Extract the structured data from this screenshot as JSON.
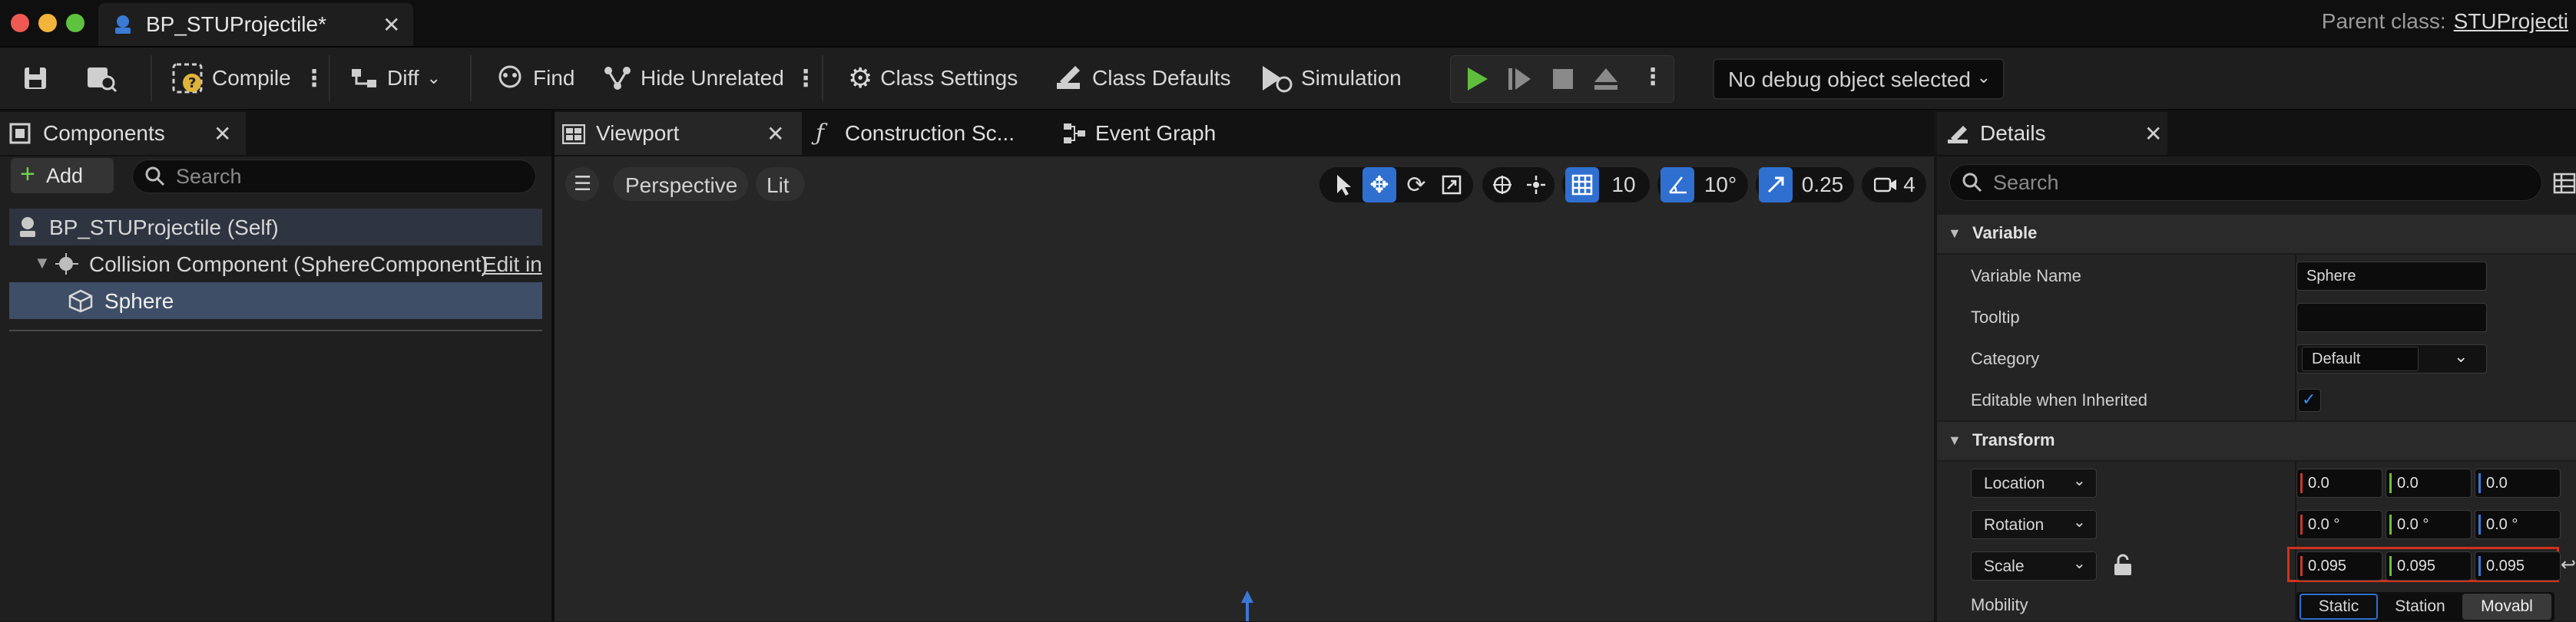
{
  "window": {
    "tab_title": "BP_STUProjectile*",
    "parent_class_label": "Parent class:",
    "parent_class_value": "STUProjecti"
  },
  "toolbar": {
    "compile": "Compile",
    "diff": "Diff",
    "find": "Find",
    "hide_unrelated": "Hide Unrelated",
    "class_settings": "Class Settings",
    "class_defaults": "Class Defaults",
    "simulation": "Simulation",
    "debug_object": "No debug object selected"
  },
  "components": {
    "tab_label": "Components",
    "add_label": "Add",
    "search_placeholder": "Search",
    "tree": [
      {
        "label": "BP_STUProjectile (Self)"
      },
      {
        "label": "Collision Component (SphereComponent)",
        "suffix": "Edit in"
      },
      {
        "label": "Sphere",
        "selected": true
      }
    ]
  },
  "viewport": {
    "tabs": [
      {
        "label": "Viewport"
      },
      {
        "label": "Construction Sc..."
      },
      {
        "label": "Event Graph"
      }
    ],
    "perspective_label": "Perspective",
    "lit_label": "Lit",
    "grid_snap": "10",
    "rotation_snap": "10°",
    "scale_snap": "0.25",
    "camera_speed": "4"
  },
  "details": {
    "tab_label": "Details",
    "search_placeholder": "Search",
    "sections": {
      "variable": "Variable",
      "transform": "Transform"
    },
    "variable": {
      "name_label": "Variable Name",
      "name_value": "Sphere",
      "tooltip_label": "Tooltip",
      "tooltip_value": "",
      "category_label": "Category",
      "category_value": "Default",
      "editable_label": "Editable when Inherited",
      "editable_checked": true
    },
    "transform": {
      "location_label": "Location",
      "location": [
        "0.0",
        "0.0",
        "0.0"
      ],
      "rotation_label": "Rotation",
      "rotation": [
        "0.0 °",
        "0.0 °",
        "0.0 °"
      ],
      "scale_label": "Scale",
      "scale": [
        "0.095",
        "0.095",
        "0.095"
      ],
      "mobility_label": "Mobility",
      "mobility_options": [
        "Static",
        "Station",
        "Movabl"
      ],
      "mobility_selected": "Movabl"
    }
  },
  "colors": {
    "accent_blue": "#2f6fd0",
    "play_green": "#5fbf3c",
    "highlight_red": "#d0321e",
    "axis_x": "#c8382a",
    "axis_y": "#6dbf3c",
    "axis_z": "#3a78d6"
  }
}
